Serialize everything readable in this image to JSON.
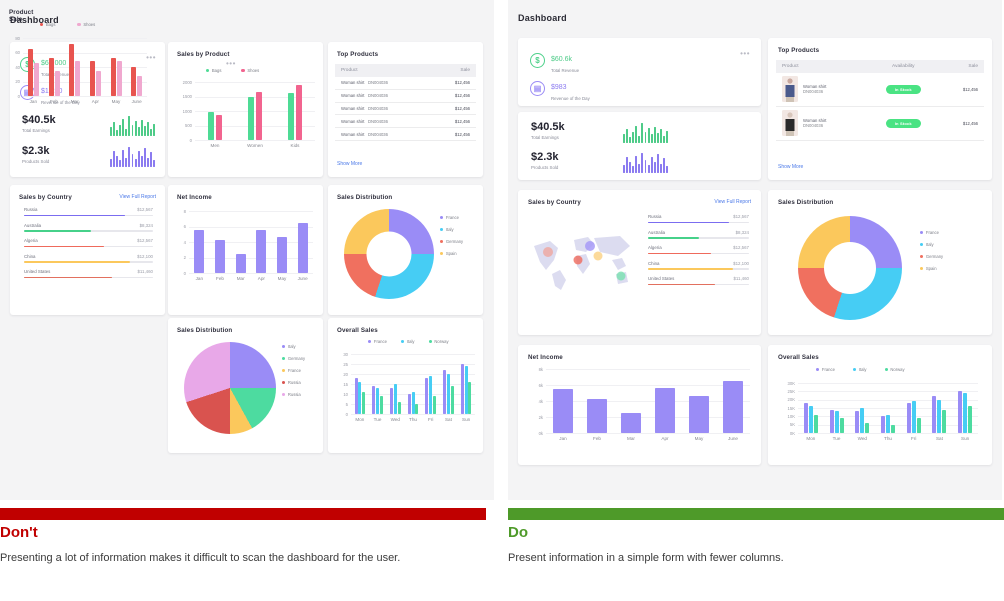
{
  "left": {
    "dashboard_title": "Dashboard",
    "revenue_card": {
      "menu_icon": "ellipsis-icon",
      "items": [
        {
          "icon": "dollar-circle-icon",
          "value": "$60,000",
          "label": "Total Revenue",
          "color": "#4ecb88"
        },
        {
          "icon": "receipt-circle-icon",
          "value": "$1,250",
          "label": "Revenue of the Day",
          "color": "#8b7bf0"
        }
      ],
      "stats": [
        {
          "value": "$40.5k",
          "label": "Total Earnings",
          "spark_color": "#4ecb88",
          "spark": [
            7,
            11,
            5,
            9,
            14,
            6,
            16,
            9,
            12,
            7,
            13,
            8,
            11,
            6,
            10
          ]
        },
        {
          "value": "$2.3k",
          "label": "Products Sold",
          "spark_color": "#8b7bf0",
          "spark": [
            6,
            12,
            8,
            5,
            13,
            7,
            15,
            10,
            6,
            12,
            8,
            14,
            7,
            11,
            5
          ]
        }
      ]
    },
    "sales_by_product": {
      "title": "Sales by Product",
      "menu_icon": "ellipsis-icon",
      "chart_data": {
        "type": "bar",
        "title": "Sales by Product",
        "categories": [
          "Men",
          "Women",
          "Kids"
        ],
        "series": [
          {
            "name": "Bags",
            "color": "#4edb95",
            "values": [
              950,
              1480,
              1630
            ]
          },
          {
            "name": "Shoes",
            "color": "#f2648f",
            "values": [
              870,
              1670,
              1880
            ]
          }
        ],
        "ylim": [
          0,
          2000
        ],
        "yticks": [
          0,
          500,
          1000,
          1500,
          2000
        ],
        "xlabel": "",
        "ylabel": "",
        "grid": true,
        "legend": "top"
      }
    },
    "top_products": {
      "title": "Top Products",
      "columns": [
        "Product",
        "Sale"
      ],
      "rows": [
        {
          "product": "Woman shirt",
          "code": "DN004036",
          "sale": "$12,456"
        },
        {
          "product": "Woman shirt",
          "code": "DN004036",
          "sale": "$12,456"
        },
        {
          "product": "Woman shirt",
          "code": "DN004036",
          "sale": "$12,456"
        },
        {
          "product": "Woman shirt",
          "code": "DN004036",
          "sale": "$12,456"
        },
        {
          "product": "Woman shirt",
          "code": "DN004036",
          "sale": "$12,456"
        }
      ],
      "show_more": "Show More"
    },
    "sales_by_country": {
      "title": "Sales by Country",
      "action": "View Full Report",
      "rows": [
        {
          "name": "Russia",
          "value": "$12,567",
          "pct": 78,
          "color": "#7b6df0"
        },
        {
          "name": "Australia",
          "value": "$8,324",
          "pct": 52,
          "color": "#46d18a"
        },
        {
          "name": "Algeria",
          "value": "$12,567",
          "pct": 62,
          "color": "#ef6a5c"
        },
        {
          "name": "China",
          "value": "$12,100",
          "pct": 82,
          "color": "#fbc85c"
        },
        {
          "name": "United States",
          "value": "$11,460",
          "pct": 68,
          "color": "#e2705f"
        }
      ]
    },
    "net_income": {
      "title": "Net Income",
      "chart_data": {
        "type": "bar",
        "title": "Net Income",
        "categories": [
          "Jan",
          "Feb",
          "Mar",
          "Apr",
          "May",
          "June"
        ],
        "values": [
          5.5,
          4.3,
          2.5,
          5.6,
          4.6,
          6.5
        ],
        "color": "#9a8cf6",
        "ylim": [
          0,
          8
        ],
        "yticks": [
          0,
          2,
          4,
          6,
          8
        ],
        "xlabel": "",
        "ylabel": "",
        "grid": true
      }
    },
    "sales_distribution": {
      "title": "Sales Distribution",
      "chart_data": {
        "type": "pie",
        "title": "Sales Distribution",
        "variant": "donut",
        "labels": [
          "France",
          "Italy",
          "Germany",
          "Spain"
        ],
        "values": [
          25,
          30,
          20,
          25
        ],
        "colors": [
          "#9a8cf6",
          "#46cdf4",
          "#f0705f",
          "#fbc85c"
        ],
        "legend": "right"
      }
    },
    "product_sale": {
      "title": "Product Sale",
      "chart_data": {
        "type": "bar",
        "title": "Product Sale",
        "categories": [
          "Jan",
          "Feb",
          "Mar",
          "Apr",
          "May",
          "June"
        ],
        "series": [
          {
            "name": "Bags",
            "color": "#e8544f",
            "values": [
              65,
              53,
              72,
              48,
              52,
              40
            ]
          },
          {
            "name": "Shoes",
            "color": "#f0a8cf",
            "values": [
              45,
              35,
              48,
              35,
              48,
              27
            ]
          }
        ],
        "ylim": [
          0,
          80
        ],
        "yticks": [
          0,
          20,
          40,
          60,
          80
        ],
        "xlabel": "",
        "ylabel": "",
        "grid": true,
        "legend": "top"
      }
    },
    "sales_distribution_pie": {
      "title": "Sales Distribution",
      "chart_data": {
        "type": "pie",
        "title": "Sales Distribution",
        "variant": "pie",
        "labels": [
          "Italy",
          "Germany",
          "France",
          "Russia",
          "Russia"
        ],
        "values": [
          25,
          17,
          8,
          20,
          30
        ],
        "colors": [
          "#9a8cf6",
          "#4ddba0",
          "#fbc85c",
          "#d9534f",
          "#e8a8e8"
        ],
        "legend": "right"
      }
    },
    "overall_sales": {
      "title": "Overall Sales",
      "chart_data": {
        "type": "bar",
        "title": "Overall Sales",
        "categories": [
          "Mon",
          "Tue",
          "Wed",
          "Thu",
          "Fri",
          "Sat",
          "Sun"
        ],
        "series": [
          {
            "name": "France",
            "color": "#9a8cf6",
            "values": [
              18,
              14,
              13,
              10,
              18,
              22,
              25
            ]
          },
          {
            "name": "Italy",
            "color": "#46cdf4",
            "values": [
              16,
              13,
              15,
              11,
              19,
              20,
              24
            ]
          },
          {
            "name": "Norway",
            "color": "#4ddba0",
            "values": [
              11,
              9,
              6,
              5,
              9,
              14,
              16
            ]
          }
        ],
        "ylim": [
          0,
          30
        ],
        "yticks": [
          0,
          5,
          10,
          15,
          20,
          25,
          30
        ],
        "xlabel": "",
        "ylabel": "",
        "grid": true,
        "legend": "top"
      }
    }
  },
  "right": {
    "dashboard_title": "Dashboard",
    "revenue_card": {
      "menu_icon": "ellipsis-icon",
      "items": [
        {
          "icon": "dollar-circle-icon",
          "value": "$60.6k",
          "label": "Total Revenue",
          "color": "#4ecb88"
        },
        {
          "icon": "receipt-circle-icon",
          "value": "$983",
          "label": "Revenue of the Day",
          "color": "#8b7bf0"
        }
      ]
    },
    "stats_card": {
      "stats": [
        {
          "value": "$40.5k",
          "label": "Total Earnings",
          "spark_color": "#4ecb88",
          "spark": [
            7,
            11,
            5,
            9,
            14,
            6,
            16,
            9,
            12,
            7,
            13,
            8,
            11,
            6,
            10
          ]
        },
        {
          "value": "$2.3k",
          "label": "Products Sold",
          "spark_color": "#8b7bf0",
          "spark": [
            6,
            12,
            8,
            5,
            13,
            7,
            15,
            10,
            6,
            12,
            8,
            14,
            7,
            11,
            5
          ]
        }
      ]
    },
    "top_products": {
      "title": "Top Products",
      "columns": [
        "Product",
        "Availability",
        "Sale"
      ],
      "rows": [
        {
          "image": "woman-shirt-blue-photo",
          "product": "Woman shirt",
          "code": "DN004036",
          "availability": "In Stock",
          "sale": "$12,456"
        },
        {
          "image": "woman-shirt-black-photo",
          "product": "Woman shirt",
          "code": "DN004036",
          "availability": "In Stock",
          "sale": "$12,456"
        }
      ],
      "show_more": "Show More"
    },
    "sales_by_country": {
      "title": "Sales by Country",
      "action": "View Full Report",
      "map_icon": "world-map-graphic",
      "rows": [
        {
          "name": "Russia",
          "value": "$12,567",
          "pct": 80,
          "color": "#7b6df0"
        },
        {
          "name": "Australia",
          "value": "$8,324",
          "pct": 50,
          "color": "#46d18a"
        },
        {
          "name": "Algeria",
          "value": "$12,567",
          "pct": 62,
          "color": "#ef6a5c"
        },
        {
          "name": "China",
          "value": "$12,100",
          "pct": 84,
          "color": "#fbc85c"
        },
        {
          "name": "United States",
          "value": "$11,460",
          "pct": 66,
          "color": "#e2705f"
        }
      ]
    },
    "sales_distribution": {
      "title": "Sales Distribution",
      "chart_data": {
        "type": "pie",
        "title": "Sales Distribution",
        "variant": "donut",
        "labels": [
          "France",
          "Italy",
          "Germany",
          "Spain"
        ],
        "values": [
          25,
          30,
          20,
          25
        ],
        "colors": [
          "#9a8cf6",
          "#46cdf4",
          "#f0705f",
          "#fbc85c"
        ],
        "legend": "right"
      }
    },
    "net_income": {
      "title": "Net Income",
      "chart_data": {
        "type": "bar",
        "title": "Net Income",
        "categories": [
          "Jan",
          "Feb",
          "Mar",
          "Apr",
          "May",
          "June"
        ],
        "values": [
          5.5,
          4.3,
          2.5,
          5.6,
          4.6,
          6.5
        ],
        "color": "#9a8cf6",
        "ylim": [
          0,
          8
        ],
        "yticks": [
          "0k",
          "2k",
          "4k",
          "6k",
          "8k"
        ],
        "xlabel": "",
        "ylabel": "",
        "grid": true
      }
    },
    "overall_sales": {
      "title": "Overall Sales",
      "chart_data": {
        "type": "bar",
        "title": "Overall Sales",
        "categories": [
          "Mon",
          "Tue",
          "Wed",
          "Thu",
          "Fri",
          "Sat",
          "Sun"
        ],
        "series": [
          {
            "name": "France",
            "color": "#9a8cf6",
            "values": [
              18,
              14,
              13,
              10,
              18,
              22,
              25
            ]
          },
          {
            "name": "Italy",
            "color": "#46cdf4",
            "values": [
              16,
              13,
              15,
              11,
              19,
              20,
              24
            ]
          },
          {
            "name": "Norway",
            "color": "#4ddba0",
            "values": [
              11,
              9,
              6,
              5,
              9,
              14,
              16
            ]
          }
        ],
        "ylim": [
          0,
          30
        ],
        "yticks": [
          "0K",
          "5K",
          "10K",
          "15K",
          "20K",
          "25K",
          "30K"
        ],
        "xlabel": "",
        "ylabel": "",
        "grid": true,
        "legend": "top"
      }
    }
  },
  "captions": {
    "dont_title": "Don't",
    "dont_body": "Presenting a lot of information makes it difficult to scan the dashboard for the user.",
    "do_title": "Do",
    "do_body": "Present information in a simple form with fewer columns.",
    "dont_color": "#C00000",
    "do_color": "#4E9A29"
  }
}
